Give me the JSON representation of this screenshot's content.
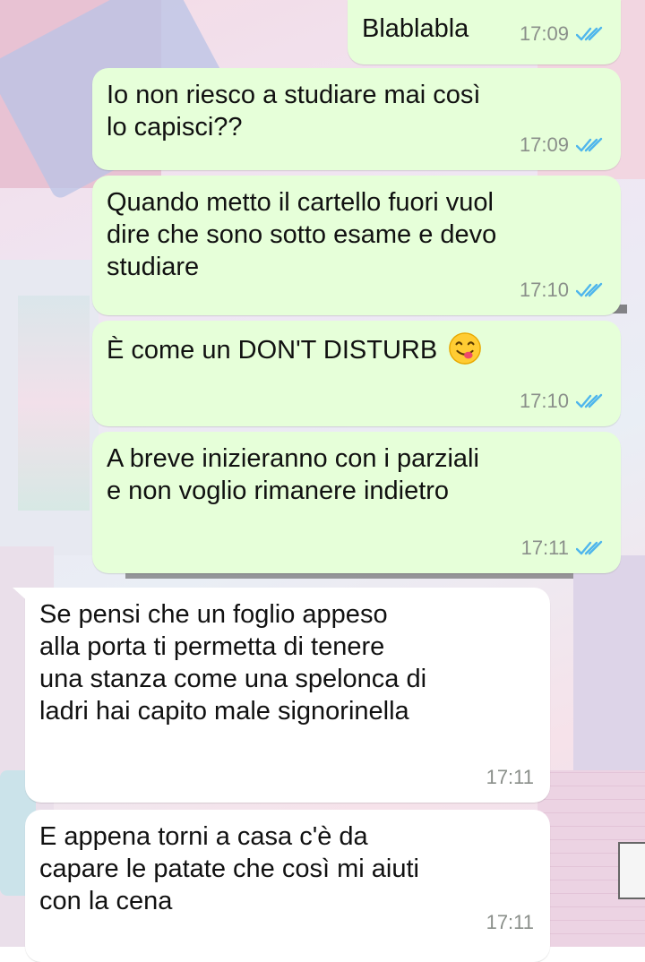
{
  "messages": [
    {
      "direction": "out",
      "text": "Blablabla",
      "time": "17:09",
      "status": "read"
    },
    {
      "direction": "out",
      "text": "Io non riesco a studiare mai così\nlo capisci??",
      "time": "17:09",
      "status": "read"
    },
    {
      "direction": "out",
      "text": "Quando metto il cartello fuori vuol\ndire che sono sotto esame e devo\nstudiare",
      "time": "17:10",
      "status": "read"
    },
    {
      "direction": "out",
      "text": "È come un DON'T DISTURB",
      "emoji": "face-savoring-food",
      "time": "17:10",
      "status": "read"
    },
    {
      "direction": "out",
      "text": "A breve inizieranno con i parziali\ne non voglio rimanere indietro",
      "time": "17:11",
      "status": "read"
    },
    {
      "direction": "in",
      "text": "Se pensi che un foglio appeso\nalla porta ti permetta di tenere\nuna stanza come una spelonca di\nladri hai capito male signorinella",
      "time": "17:11"
    },
    {
      "direction": "in",
      "text": "E appena torni a casa c'è da\ncapare le patate che così mi aiuti\ncon la cena",
      "time": "17:11"
    }
  ],
  "colors": {
    "outgoing_bubble": "#e6ffd9",
    "incoming_bubble": "#ffffff",
    "read_ticks": "#4fb6ec",
    "timestamp": "#8a8f8a"
  },
  "icons": {
    "read_status": "double-check-icon",
    "emoji": "face-savoring-food-emoji"
  }
}
